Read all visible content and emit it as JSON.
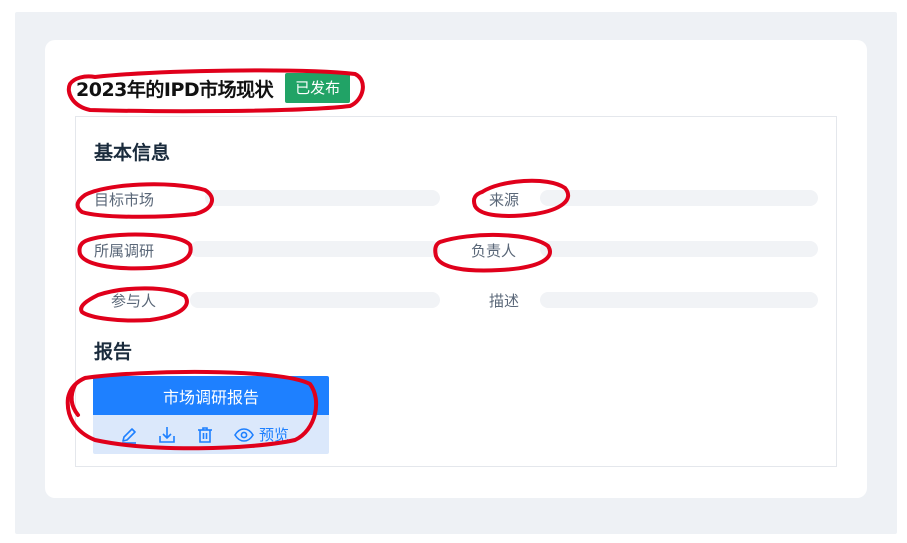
{
  "header": {
    "title": "2023年的IPD市场现状",
    "status": "已发布"
  },
  "basic_info": {
    "section_title": "基本信息",
    "fields": [
      {
        "label": "目标市场",
        "value": ""
      },
      {
        "label": "来源",
        "value": ""
      },
      {
        "label": "所属调研",
        "value": ""
      },
      {
        "label": "负责人",
        "value": ""
      },
      {
        "label": "参与人",
        "value": ""
      },
      {
        "label": "描述",
        "value": ""
      }
    ]
  },
  "report": {
    "section_title": "报告",
    "file_name": "市场调研报告",
    "actions": {
      "edit_icon": "edit-icon",
      "download_icon": "download-icon",
      "delete_icon": "delete-icon",
      "preview_icon": "eye-icon",
      "preview_label": "预览"
    }
  },
  "colors": {
    "primary": "#1e80ff",
    "status_green": "#21a366",
    "annotation_red": "#e0001b"
  }
}
